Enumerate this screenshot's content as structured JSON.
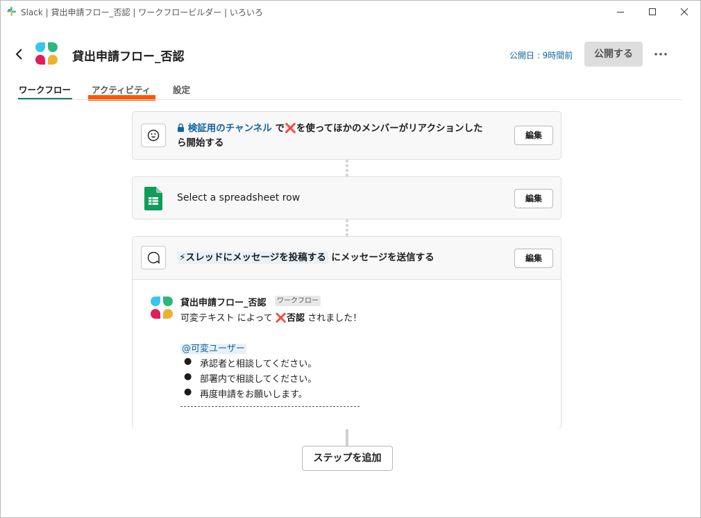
{
  "window": {
    "title": "Slack | 貸出申請フロー_否認 | ワークフロービルダー | いろいろ",
    "minimize_icon": "minimize-icon",
    "maximize_icon": "maximize-icon",
    "close_icon": "close-icon"
  },
  "header": {
    "title": "貸出申請フロー_否認",
    "published": "公開日 : 9時間前",
    "publish_label": "公開する"
  },
  "tabs": [
    {
      "label": "ワークフロー",
      "active": true
    },
    {
      "label": "アクティビティ",
      "active": false
    },
    {
      "label": "設定",
      "active": false
    }
  ],
  "steps": {
    "trigger": {
      "channel": "検証用のチャンネル",
      "text_before": " で",
      "emoji": "❌",
      "text_line1": "を使ってほかのメンバーがリアクションした",
      "text_line2": "ら開始する",
      "edit_label": "編集"
    },
    "sheet": {
      "text": "Select a spreadsheet row",
      "edit_label": "編集"
    },
    "message": {
      "step_ref": "スレッドにメッセージを投稿する",
      "text": " にメッセージを送信する",
      "edit_label": "編集",
      "preview": {
        "sender": "貸出申請フロー_否認",
        "badge": "ワークフロー",
        "line1_var": "可変テキスト",
        "line1_mid": " によって ",
        "line1_emoji": "❌",
        "line1_bold": "否認",
        "line1_end": " されました！",
        "mention": "@可変ユーザー",
        "bullets": [
          "承認者と相談してください。",
          "部署内で相談してください。",
          "再度申請をお願いします。"
        ]
      }
    }
  },
  "add_step_label": "ステップを追加",
  "colors": {
    "accent_underline": "#117d6b",
    "highlight": "#ff5500",
    "link": "#1264a3"
  }
}
